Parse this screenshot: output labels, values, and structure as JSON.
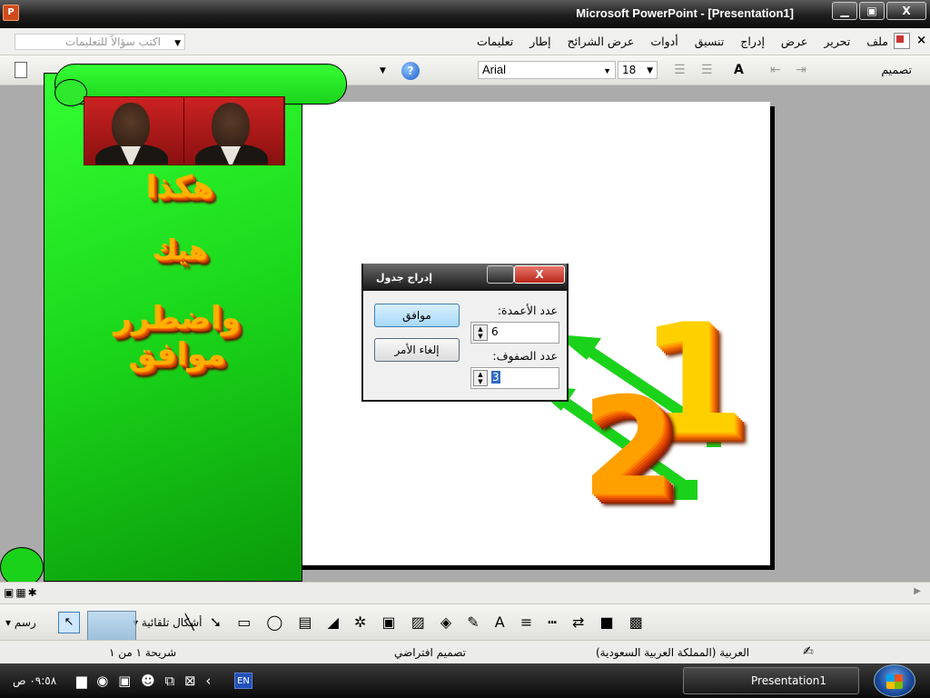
{
  "window": {
    "title": "Microsoft PowerPoint - [Presentation1]",
    "minimize": "▁",
    "maximize": "▣",
    "close": "X"
  },
  "menubar": {
    "items": [
      "ملف",
      "تحرير",
      "عرض",
      "إدراج",
      "تنسيق",
      "أدوات",
      "عرض الشرائح",
      "إطار",
      "تعليمات"
    ],
    "close": "×",
    "ask_placeholder": "اكتب سؤالاً للتعليمات"
  },
  "toolbar": {
    "font": "Arial",
    "size": "18",
    "design": "تصميم"
  },
  "slide_content": {
    "wordart_line1": "هكذا",
    "wordart_line2": "هيك",
    "wordart_line3": "واضطرر موافق"
  },
  "dialog": {
    "title": "إدراج جدول",
    "close": "X",
    "ok_label": "موافق",
    "cancel_label": "إلغاء الأمر",
    "columns_label": "عدد الأعمدة:",
    "columns_value": "6",
    "rows_label": "عدد الصفوف:",
    "rows_value": "3"
  },
  "annotations": {
    "num1": "1",
    "num2": "2",
    "arrow_color": "#1bd21b"
  },
  "drawbar": {
    "draw_label": "رسم",
    "autoshapes_label": "أشكال تلقائية"
  },
  "statusbar": {
    "slide": "شريحة ١ من ١",
    "design": "تصميم افتراضي",
    "language": "العربية (المملكة العربية السعودية)"
  },
  "taskbar": {
    "clock": "٠٩:٥٨ ص",
    "lang": "EN",
    "task": "Presentation1"
  }
}
